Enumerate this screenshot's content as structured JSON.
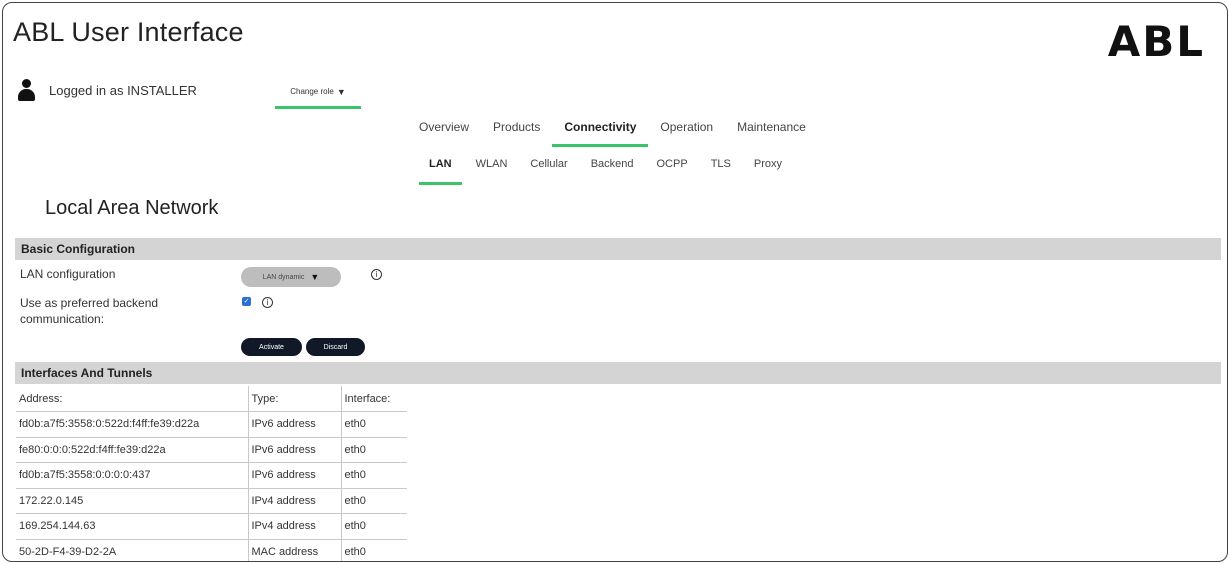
{
  "app": {
    "title": "ABL User Interface",
    "logo": "ABL"
  },
  "user": {
    "logged_in_text": "Logged in as INSTALLER",
    "icon": "user-icon",
    "change_role_label": "Change role",
    "caret": "▼"
  },
  "main_nav": {
    "items": [
      {
        "label": "Overview"
      },
      {
        "label": "Products"
      },
      {
        "label": "Connectivity",
        "active": true
      },
      {
        "label": "Operation"
      },
      {
        "label": "Maintenance"
      }
    ]
  },
  "sub_nav": {
    "items": [
      {
        "label": "LAN",
        "active": true
      },
      {
        "label": "WLAN"
      },
      {
        "label": "Cellular"
      },
      {
        "label": "Backend"
      },
      {
        "label": "OCPP"
      },
      {
        "label": "TLS"
      },
      {
        "label": "Proxy"
      }
    ]
  },
  "page": {
    "title": "Local Area Network"
  },
  "basic_config": {
    "heading": "Basic Configuration",
    "lan_config_label": "LAN configuration",
    "lan_config_value": "LAN dynamic",
    "preferred_backend_label": "Use as preferred backend communication:",
    "preferred_backend_checked": true,
    "activate_label": "Activate",
    "discard_label": "Discard",
    "info_glyph": "i"
  },
  "interfaces": {
    "heading": "Interfaces And Tunnels",
    "columns": [
      "Address:",
      "Type:",
      "Interface:"
    ],
    "rows": [
      [
        "fd0b:a7f5:3558:0:522d:f4ff:fe39:d22a",
        "IPv6 address",
        "eth0"
      ],
      [
        "fe80:0:0:0:522d:f4ff:fe39:d22a",
        "IPv6 address",
        "eth0"
      ],
      [
        "fd0b:a7f5:3558:0:0:0:0:437",
        "IPv6 address",
        "eth0"
      ],
      [
        "172.22.0.145",
        "IPv4 address",
        "eth0"
      ],
      [
        "169.254.144.63",
        "IPv4 address",
        "eth0"
      ],
      [
        "50-2D-F4-39-D2-2A",
        "MAC address",
        "eth0"
      ]
    ]
  },
  "colors": {
    "accent": "#3cc46b",
    "section_bg": "#d4d4d4",
    "button_bg": "#111827",
    "select_bg": "#bdbdbd"
  }
}
